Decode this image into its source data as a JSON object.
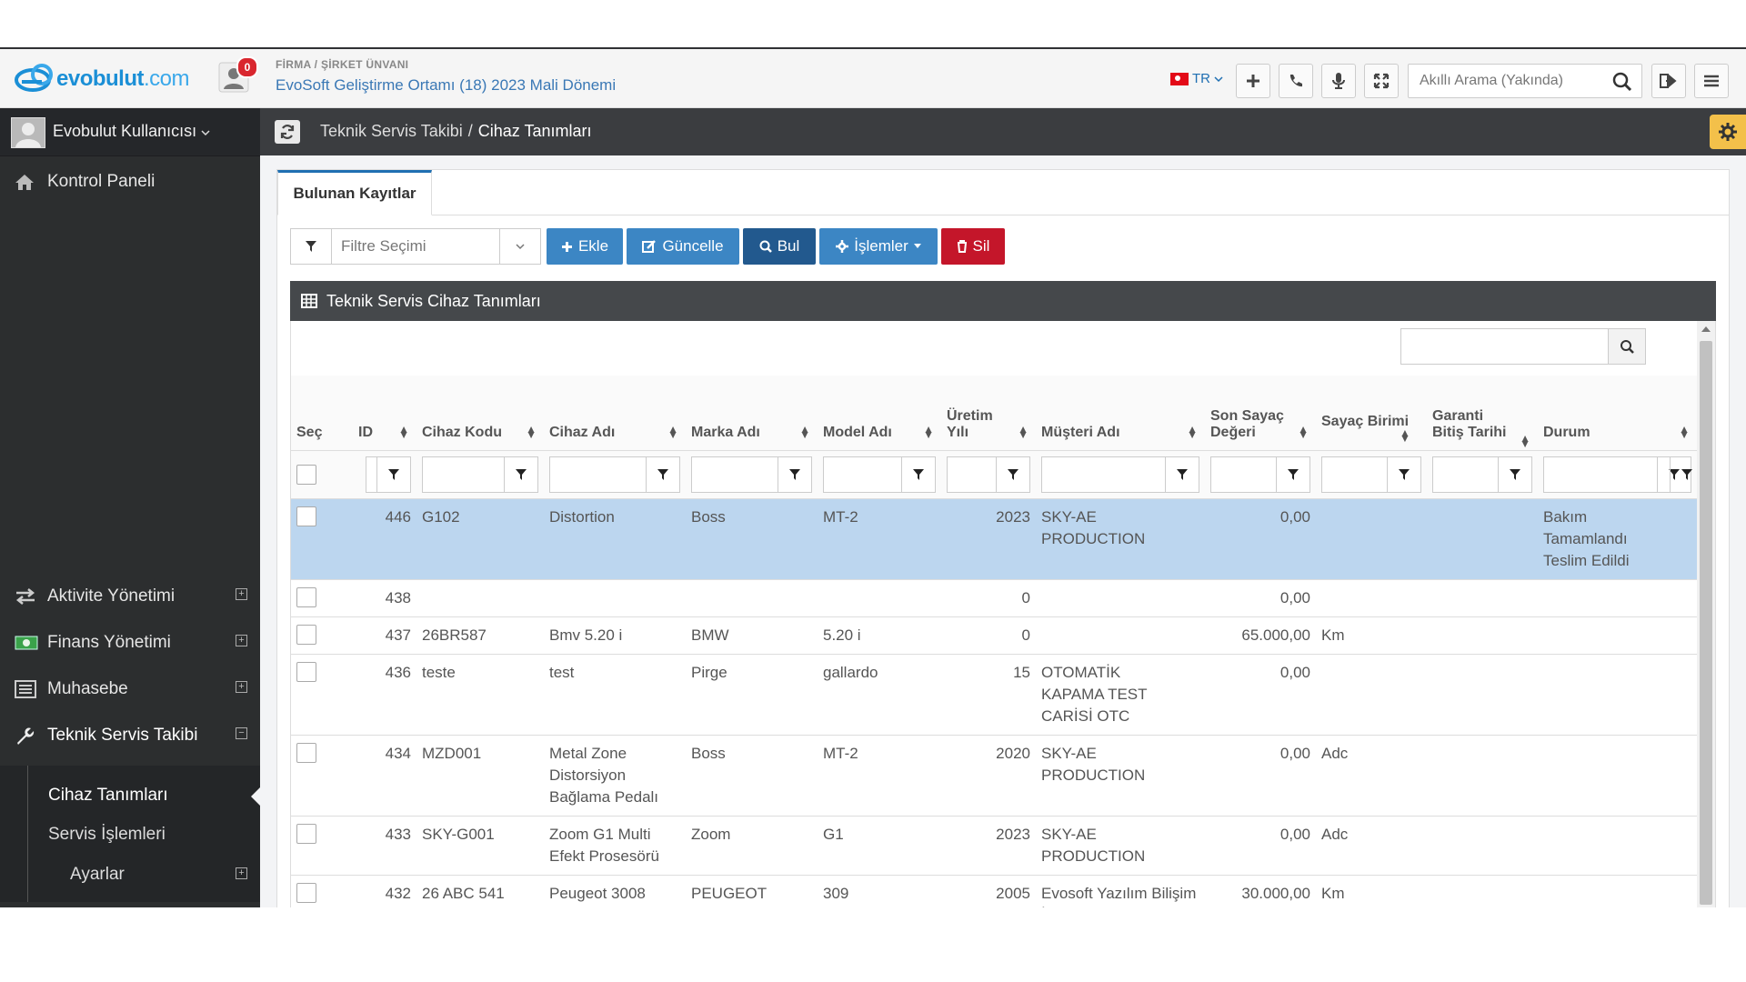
{
  "header": {
    "brand": "evobulut",
    "brand_suffix": ".com",
    "notification_count": "0",
    "company_label": "FİRMA / ŞİRKET ÜNVANI",
    "company_name": "EvoSoft Geliştirme Ortamı (18) 2023 Mali Dönemi",
    "language": "TR",
    "search_placeholder": "Akıllı Arama (Yakında)"
  },
  "sidebar": {
    "user_name": "Evobulut Kullanıcısı",
    "items": [
      {
        "label": "Kontrol Paneli",
        "icon": "home-icon"
      },
      {
        "label": "Aktivite Yönetimi",
        "icon": "exchange-icon"
      },
      {
        "label": "Finans Yönetimi",
        "icon": "money-icon"
      },
      {
        "label": "Muhasebe",
        "icon": "list-icon"
      },
      {
        "label": "Teknik Servis Takibi",
        "icon": "wrench-icon"
      }
    ],
    "submenu": [
      {
        "label": "Cihaz Tanımları"
      },
      {
        "label": "Servis İşlemleri"
      },
      {
        "label": "Ayarlar"
      }
    ]
  },
  "breadcrumb": {
    "parent": "Teknik Servis Takibi",
    "separator": "/",
    "current": "Cihaz Tanımları"
  },
  "tab": {
    "label": "Bulunan Kayıtlar"
  },
  "toolbar": {
    "filter_placeholder": "Filtre Seçimi",
    "add": "Ekle",
    "update": "Güncelle",
    "find": "Bul",
    "operations": "İşlemler",
    "delete": "Sil"
  },
  "grid": {
    "title": "Teknik Servis Cihaz Tanımları",
    "columns": {
      "sec": "Seç",
      "id": "ID",
      "kod": "Cihaz Kodu",
      "ad": "Cihaz Adı",
      "marka": "Marka Adı",
      "model": "Model Adı",
      "yil_1": "Üretim",
      "yil_2": "Yılı",
      "musteri": "Müşteri Adı",
      "sayac_1": "Son Sayaç",
      "sayac_2": "Değeri",
      "birim": "Sayaç Birimi",
      "garanti_1": "Garanti",
      "garanti_2": "Bitiş Tarihi",
      "durum": "Durum"
    },
    "rows": [
      {
        "id": "446",
        "kod": "G102",
        "ad": "Distortion",
        "marka": "Boss",
        "model": "MT-2",
        "yil": "2023",
        "musteri": "SKY-AE PRODUCTION",
        "sayac": "0,00",
        "birim": "",
        "garanti": "",
        "durum": "Bakım Tamamlandı Teslim Edildi"
      },
      {
        "id": "438",
        "kod": "",
        "ad": "",
        "marka": "",
        "model": "",
        "yil": "0",
        "musteri": "",
        "sayac": "0,00",
        "birim": "",
        "garanti": "",
        "durum": ""
      },
      {
        "id": "437",
        "kod": "26BR587",
        "ad": "Bmv 5.20 i",
        "marka": "BMW",
        "model": "5.20 i",
        "yil": "0",
        "musteri": "",
        "sayac": "65.000,00",
        "birim": "Km",
        "garanti": "",
        "durum": ""
      },
      {
        "id": "436",
        "kod": "teste",
        "ad": "test",
        "marka": "Pirge",
        "model": "gallardo",
        "yil": "15",
        "musteri": "OTOMATİK KAPAMA TEST CARİSİ OTC",
        "sayac": "0,00",
        "birim": "",
        "garanti": "",
        "durum": ""
      },
      {
        "id": "434",
        "kod": "MZD001",
        "ad": "Metal Zone Distorsiyon Bağlama Pedalı",
        "marka": "Boss",
        "model": "MT-2",
        "yil": "2020",
        "musteri": "SKY-AE PRODUCTION",
        "sayac": "0,00",
        "birim": "Adc",
        "garanti": "",
        "durum": ""
      },
      {
        "id": "433",
        "kod": "SKY-G001",
        "ad": "Zoom G1 Multi Efekt Prosesörü",
        "marka": "Zoom",
        "model": "G1",
        "yil": "2023",
        "musteri": "SKY-AE PRODUCTION",
        "sayac": "0,00",
        "birim": "Adc",
        "garanti": "",
        "durum": ""
      },
      {
        "id": "432",
        "kod": "26 ABC 541",
        "ad": "Peugeot 3008",
        "marka": "PEUGEOT",
        "model": "309",
        "yil": "2005",
        "musteri": "Evosoft Yazılım Bilişim İletişim",
        "sayac": "30.000,00",
        "birim": "Km",
        "garanti": "",
        "durum": ""
      }
    ]
  }
}
